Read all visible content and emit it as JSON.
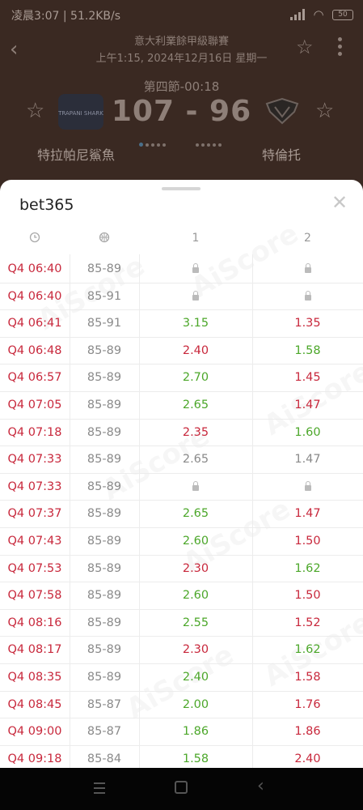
{
  "status_bar": {
    "time_network": "凌晨3:07 | 51.2KB/s",
    "battery": "50"
  },
  "header": {
    "league": "意大利業餘甲級聯賽",
    "datetime": "上午1:15, 2024年12月16日 星期一"
  },
  "match": {
    "period": "第四節-00:18",
    "score": "107 - 96",
    "home_team": "特拉帕尼鯊魚",
    "home_logo_text": "TRAPANI SHARK",
    "away_team": "特倫托"
  },
  "sheet": {
    "title": "bet365",
    "columns": [
      "",
      "",
      "1",
      "2"
    ],
    "rows": [
      {
        "time": "Q4 06:40",
        "score": "85-89",
        "o1": "",
        "o1c": "lock",
        "o2": "",
        "o2c": "lock"
      },
      {
        "time": "Q4 06:40",
        "score": "85-91",
        "o1": "",
        "o1c": "lock",
        "o2": "",
        "o2c": "lock"
      },
      {
        "time": "Q4 06:41",
        "score": "85-91",
        "o1": "3.15",
        "o1c": "green",
        "o2": "1.35",
        "o2c": "red"
      },
      {
        "time": "Q4 06:48",
        "score": "85-89",
        "o1": "2.40",
        "o1c": "red",
        "o2": "1.58",
        "o2c": "green"
      },
      {
        "time": "Q4 06:57",
        "score": "85-89",
        "o1": "2.70",
        "o1c": "green",
        "o2": "1.45",
        "o2c": "red"
      },
      {
        "time": "Q4 07:05",
        "score": "85-89",
        "o1": "2.65",
        "o1c": "green",
        "o2": "1.47",
        "o2c": "red"
      },
      {
        "time": "Q4 07:18",
        "score": "85-89",
        "o1": "2.35",
        "o1c": "red",
        "o2": "1.60",
        "o2c": "green"
      },
      {
        "time": "Q4 07:33",
        "score": "85-89",
        "o1": "2.65",
        "o1c": "gray",
        "o2": "1.47",
        "o2c": "gray"
      },
      {
        "time": "Q4 07:33",
        "score": "85-89",
        "o1": "",
        "o1c": "lock",
        "o2": "",
        "o2c": "lock"
      },
      {
        "time": "Q4 07:37",
        "score": "85-89",
        "o1": "2.65",
        "o1c": "green",
        "o2": "1.47",
        "o2c": "red"
      },
      {
        "time": "Q4 07:43",
        "score": "85-89",
        "o1": "2.60",
        "o1c": "green",
        "o2": "1.50",
        "o2c": "red"
      },
      {
        "time": "Q4 07:53",
        "score": "85-89",
        "o1": "2.30",
        "o1c": "red",
        "o2": "1.62",
        "o2c": "green"
      },
      {
        "time": "Q4 07:58",
        "score": "85-89",
        "o1": "2.60",
        "o1c": "green",
        "o2": "1.50",
        "o2c": "red"
      },
      {
        "time": "Q4 08:16",
        "score": "85-89",
        "o1": "2.55",
        "o1c": "green",
        "o2": "1.52",
        "o2c": "red"
      },
      {
        "time": "Q4 08:17",
        "score": "85-89",
        "o1": "2.30",
        "o1c": "red",
        "o2": "1.62",
        "o2c": "green"
      },
      {
        "time": "Q4 08:35",
        "score": "85-89",
        "o1": "2.40",
        "o1c": "green",
        "o2": "1.58",
        "o2c": "red"
      },
      {
        "time": "Q4 08:45",
        "score": "85-87",
        "o1": "2.00",
        "o1c": "green",
        "o2": "1.76",
        "o2c": "red"
      },
      {
        "time": "Q4 09:00",
        "score": "85-87",
        "o1": "1.86",
        "o1c": "green",
        "o2": "1.86",
        "o2c": "red"
      },
      {
        "time": "Q4 09:18",
        "score": "85-84",
        "o1": "1.58",
        "o1c": "green",
        "o2": "2.40",
        "o2c": "red"
      }
    ]
  },
  "colors": {
    "header_bg": "#3a2922",
    "red": "#c8283c",
    "green": "#4ca72a",
    "gray": "#8a8a8a"
  },
  "icons": [
    "back-icon",
    "star-icon",
    "more-icon",
    "close-icon",
    "clock-icon",
    "basketball-icon",
    "lock-icon",
    "menu-icon",
    "home-icon"
  ]
}
